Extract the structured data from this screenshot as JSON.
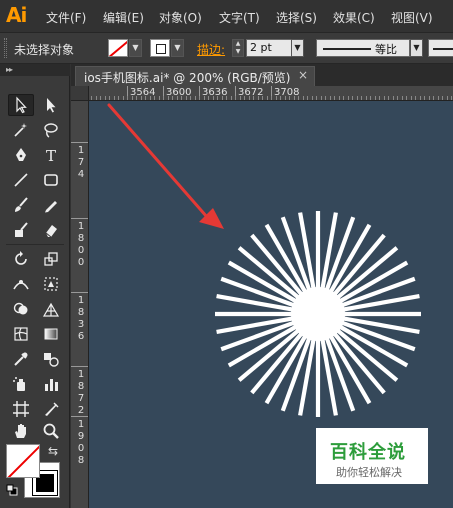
{
  "app": {
    "logo": "Ai",
    "accent_color": "#ff9a00"
  },
  "menu": [
    "文件(F)",
    "编辑(E)",
    "对象(O)",
    "文字(T)",
    "选择(S)",
    "效果(C)",
    "视图(V)"
  ],
  "control_bar": {
    "selection_status": "未选择对象",
    "stroke_label": "描边:",
    "stroke_weight": "2 pt",
    "profile_label": "等比"
  },
  "document": {
    "tab_title": "ios手机图标.ai* @ 200% (RGB/预览)",
    "close_glyph": "×"
  },
  "ruler": {
    "top_labels": [
      "3564",
      "3600",
      "3636",
      "3672",
      "3708"
    ],
    "left_labels": [
      "1",
      "7",
      "4",
      "1",
      "8",
      "0",
      "0",
      "1",
      "8",
      "3",
      "6",
      "1",
      "8",
      "7",
      "2",
      "1",
      "9",
      "0",
      "8"
    ]
  },
  "canvas": {
    "background": "#35485a",
    "burst_color": "#ffffff",
    "arrow_color": "#e53935",
    "burst_rays": 36
  },
  "watermark": {
    "main": "百科全说",
    "sub": "助你轻松解决"
  },
  "colors": {
    "fill": "none",
    "stroke": "#000000"
  }
}
